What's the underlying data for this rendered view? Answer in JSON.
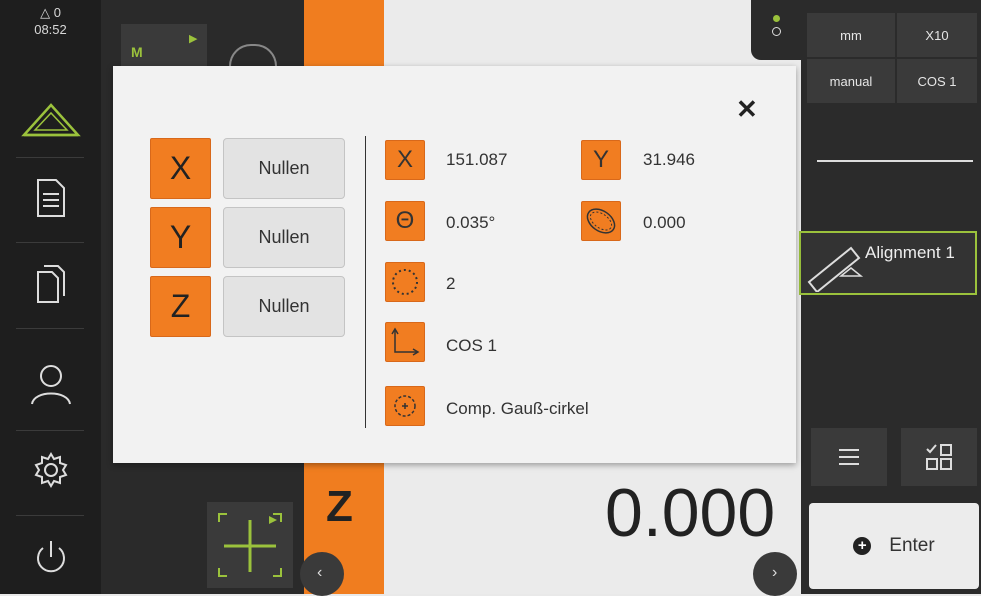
{
  "status": {
    "triangle_count": "0",
    "time": "08:52"
  },
  "sidebar": {
    "items": [
      {
        "icon": "measure-icon"
      },
      {
        "icon": "report-icon"
      },
      {
        "icon": "files-icon"
      },
      {
        "icon": "user-icon"
      },
      {
        "icon": "settings-icon"
      },
      {
        "icon": "power-icon"
      }
    ]
  },
  "right_panel": {
    "unit": "mm",
    "scale": "X10",
    "mode": "manual",
    "cos": "COS 1",
    "feature_label": "Alignment 1",
    "enter_label": "Enter"
  },
  "workspace": {
    "axis_label": "Z",
    "big_value": "0.000"
  },
  "dialog": {
    "axes": [
      {
        "axis": "X",
        "button": "Nullen"
      },
      {
        "axis": "Y",
        "button": "Nullen"
      },
      {
        "axis": "Z",
        "button": "Nullen"
      }
    ],
    "x_label": "X",
    "x_value": "151.087",
    "y_label": "Y",
    "y_value": "31.946",
    "angle_icon": "Θ",
    "angle_value": "0.035°",
    "form_value": "0.000",
    "points_value": "2",
    "cos_value": "COS 1",
    "fit_value": "Comp. Gauß-cirkel"
  },
  "colors": {
    "accent": "#f17d21",
    "sidebar": "#1e1e1e",
    "feature_border": "#9bc23c"
  }
}
